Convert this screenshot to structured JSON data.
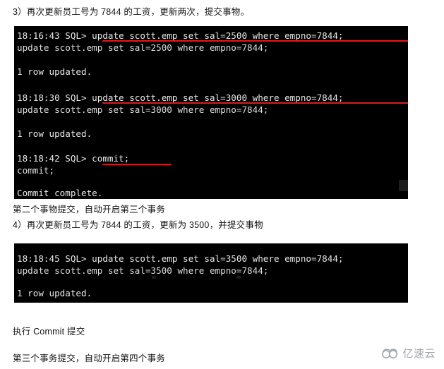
{
  "page": {
    "background_color": "#ffffff",
    "terminal_background": "#000000",
    "terminal_text_color": "#e8e8e8",
    "highlight_color": "#e01b1b"
  },
  "prose": {
    "step3": "3）再次更新员工号为 7844 的工资，更新两次，提交事物。",
    "after_block1_line1": "第二个事物提交，自动开启第三个事务",
    "after_block1_line2": "4）再次更新员工号为 7844 的工资，更新为 3500，并提交事物",
    "after_block2_line1": "执行 Commit 提交",
    "after_block2_line2": "第三个事务提交，自动开启第四个事务"
  },
  "terminal1": {
    "lines": [
      "18:16:43 SQL> update scott.emp set sal=2500 where empno=7844;",
      "update scott.emp set sal=2500 where empno=7844;",
      "",
      "1 row updated.",
      "",
      "18:18:30 SQL> update scott.emp set sal=3000 where empno=7844;",
      "update scott.emp set sal=3000 where empno=7844;",
      "",
      "1 row updated.",
      "",
      "18:18:42 SQL> commit;",
      "commit;",
      "",
      "Commit complete."
    ]
  },
  "terminal2": {
    "lines": [
      "18:18:45 SQL> update scott.emp set sal=3500 where empno=7844;",
      "update scott.emp set sal=3500 where empno=7844;",
      "",
      "1 row updated."
    ]
  },
  "watermark": {
    "text": "亿速云",
    "icon": "cloud-icon",
    "color": "#9aa3ab"
  }
}
